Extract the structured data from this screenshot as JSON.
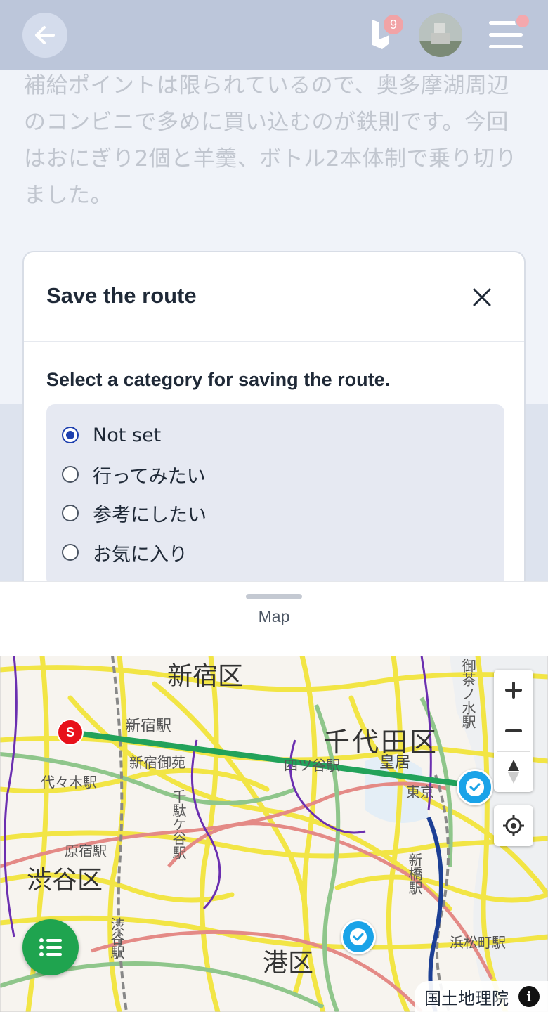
{
  "header": {
    "notification_count": "9",
    "icons": {
      "back": "arrow-left-icon",
      "brand": "brand-logo-icon",
      "menu": "hamburger-menu-icon"
    }
  },
  "article": {
    "body_text": "補給ポイントは限られているので、奥多摩湖周辺のコンビニで多めに買い込むのが鉄則です。今回はおにぎり2個と羊羹、ボトル2本体制で乗り切りました。"
  },
  "modal": {
    "title": "Save the route",
    "subtitle": "Select a category for saving the route.",
    "options": [
      {
        "label": "Not set",
        "selected": true
      },
      {
        "label": "行ってみたい",
        "selected": false
      },
      {
        "label": "参考にしたい",
        "selected": false
      },
      {
        "label": "お気に入り",
        "selected": false
      }
    ]
  },
  "bottom_sheet": {
    "label": "Map"
  },
  "map": {
    "start_marker": "S",
    "route_color": "#22a25a",
    "attribution": "国土地理院",
    "labels": {
      "shinjuku_ku": "新宿区",
      "chiyoda_ku": "千代田区",
      "shibuya_ku": "渋谷区",
      "minato_ku": "港区",
      "shinjuku_eki": "新宿駅",
      "shinjuku_gyoen": "新宿御苑",
      "harajuku_eki": "原宿駅",
      "yoyogi_eki": "代々木駅",
      "sendagaya_eki": "千駄ケ谷駅",
      "shinbashi_eki": "新橋駅",
      "hamamatsucho_eki": "浜松町駅",
      "kokyo": "皇居",
      "yotsuya_eki": "四ツ谷駅",
      "tokyo": "東京",
      "ochanomizu": "御茶ノ水駅",
      "shibuya_eki": "渋谷駅"
    }
  }
}
